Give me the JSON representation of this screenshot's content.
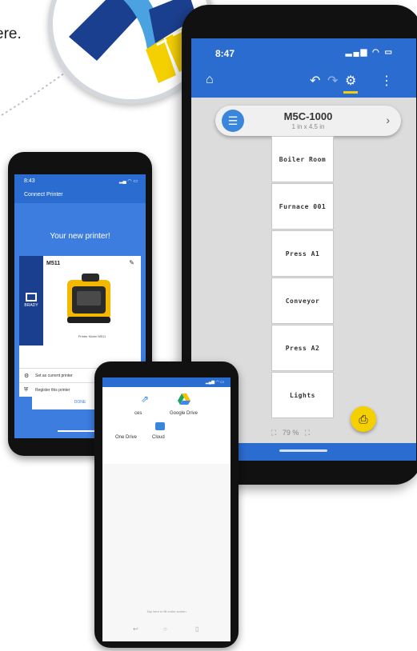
{
  "intro": {
    "trailing_text": "ere."
  },
  "logo": {
    "colors": {
      "dark_blue": "#1b3f8f",
      "light_blue": "#4aa3e0",
      "yellow": "#f5d000"
    }
  },
  "big_phone": {
    "status": {
      "time": "8:47",
      "icons": "signal-wifi-battery"
    },
    "toolbar": {
      "icons": [
        "home-icon",
        "undo-icon",
        "redo-icon",
        "settings-icon",
        "more-icon"
      ]
    },
    "template": {
      "model": "M5C-1000",
      "size": "1 in x 4.5 in"
    },
    "labels": [
      "Boiler Room",
      "Furnace 001",
      "Press A1",
      "Conveyor",
      "Press A2",
      "Lights"
    ],
    "zoom": "79 %",
    "accent_color": "#2b6cd0",
    "fab_color": "#f5d000"
  },
  "left_phone": {
    "status": {
      "time": "8:43"
    },
    "header": "Connect Printer",
    "title": "Your new printer!",
    "card": {
      "model": "M511",
      "printer_model_label": "Printer Model M511",
      "brand": "BRADY"
    },
    "rows": [
      {
        "label": "Set as current printer",
        "toggle_on": true
      },
      {
        "label": "Register this printer"
      }
    ],
    "done_button": "DONE"
  },
  "mid_phone": {
    "apps": [
      {
        "label": "Google Drive"
      },
      {
        "label": "One Drive"
      },
      {
        "label": "Cloud"
      }
    ],
    "partial_label": "ces",
    "footer": "Tap here to fill entire screen"
  }
}
